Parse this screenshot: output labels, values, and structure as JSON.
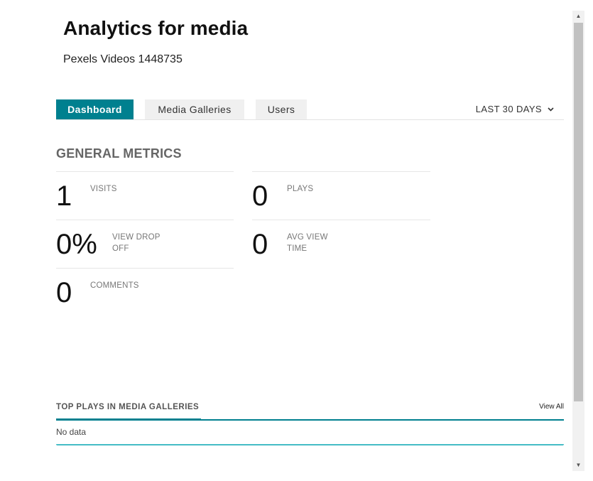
{
  "header": {
    "title": "Analytics for media",
    "subtitle": "Pexels Videos 1448735"
  },
  "tabs": [
    {
      "label": "Dashboard",
      "active": true
    },
    {
      "label": "Media Galleries",
      "active": false
    },
    {
      "label": "Users",
      "active": false
    }
  ],
  "date_range": {
    "label": "LAST 30 DAYS",
    "icon": "chevron-down-icon"
  },
  "general_metrics": {
    "title": "GENERAL METRICS",
    "visits": {
      "value": "1",
      "label": "VISITS"
    },
    "plays": {
      "value": "0",
      "label": "PLAYS"
    },
    "view_drop_off": {
      "value": "0%",
      "label": "VIEW DROP OFF"
    },
    "avg_view_time": {
      "value": "0",
      "label": "AVG VIEW TIME"
    },
    "comments": {
      "value": "0",
      "label": "COMMENTS"
    }
  },
  "top_plays": {
    "title": "TOP PLAYS IN MEDIA GALLERIES",
    "view_all": "View All",
    "empty_text": "No data"
  },
  "colors": {
    "accent": "#00808f",
    "accent_light": "#45bcc6",
    "tab_inactive_bg": "#f0f0f0"
  }
}
